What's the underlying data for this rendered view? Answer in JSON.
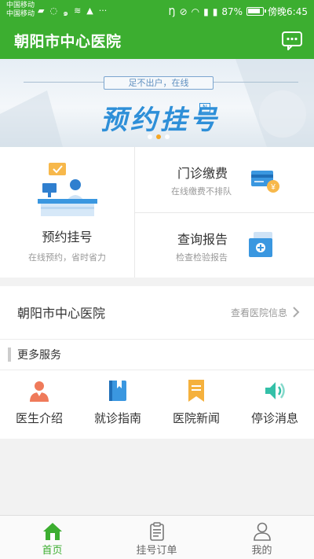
{
  "status_bar": {
    "carrier_1": "中国移动",
    "carrier_2": "中国移动",
    "battery": "87%",
    "battery_level": 0.87,
    "time": "傍晚6:45",
    "icons_left": [
      "briefcase-icon",
      "circle-icon",
      "swirl-icon",
      "wifi-small-icon",
      "android-icon",
      "more-icon"
    ],
    "icons_right": [
      "nfc-icon",
      "mute-icon",
      "wifi-icon",
      "signal-icon",
      "signal-icon"
    ]
  },
  "app_bar": {
    "title": "朝阳市中心医院",
    "message_icon": "message-icon",
    "color": "#3cae30"
  },
  "banner": {
    "tagline": "足不出户，在线",
    "title": "预约挂号",
    "badge": "N",
    "pager": {
      "count": 3,
      "active": 1
    }
  },
  "services": {
    "appointment": {
      "title": "预约挂号",
      "subtitle": "在线预约，省时省力",
      "icon": "reception-desk-icon"
    },
    "payment": {
      "title": "门诊缴费",
      "subtitle": "在线缴费不排队",
      "icon": "card-payment-icon"
    },
    "report": {
      "title": "查询报告",
      "subtitle": "检查检验报告",
      "icon": "report-folder-icon"
    }
  },
  "hospital": {
    "name": "朝阳市中心医院",
    "link": "查看医院信息"
  },
  "more_services": {
    "title": "更多服务",
    "items": [
      {
        "label": "医生介绍",
        "icon": "doctor-icon",
        "color": "#ef7a5a"
      },
      {
        "label": "就诊指南",
        "icon": "guide-book-icon",
        "color": "#3a97e0"
      },
      {
        "label": "医院新闻",
        "icon": "news-bookmark-icon",
        "color": "#f5b13d"
      },
      {
        "label": "停诊消息",
        "icon": "speaker-icon",
        "color": "#34c0a8"
      }
    ]
  },
  "tabs": [
    {
      "label": "首页",
      "icon": "home-icon",
      "active": true
    },
    {
      "label": "挂号订单",
      "icon": "clipboard-icon",
      "active": false
    },
    {
      "label": "我的",
      "icon": "user-icon",
      "active": false
    }
  ]
}
